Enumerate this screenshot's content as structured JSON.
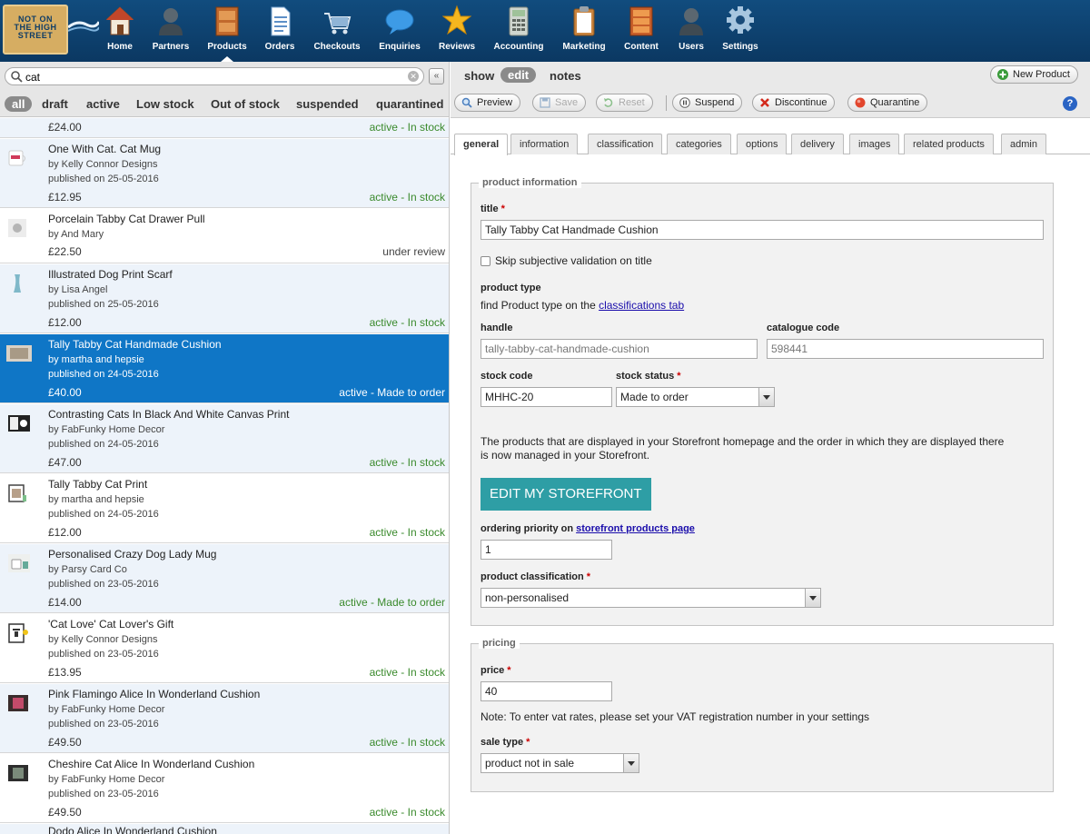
{
  "nav": {
    "logo_lines": [
      "NOT ON",
      "THE HIGH",
      "STREET"
    ],
    "items": [
      {
        "label": "Home",
        "icon": "house-icon"
      },
      {
        "label": "Partners",
        "icon": "person-icon"
      },
      {
        "label": "Products",
        "icon": "cabinet-icon",
        "active": true
      },
      {
        "label": "Orders",
        "icon": "document-icon"
      },
      {
        "label": "Checkouts",
        "icon": "cart-icon"
      },
      {
        "label": "Enquiries",
        "icon": "speech-bubble-icon"
      },
      {
        "label": "Reviews",
        "icon": "star-icon"
      },
      {
        "label": "Accounting",
        "icon": "calculator-icon"
      },
      {
        "label": "Marketing",
        "icon": "clipboard-icon"
      },
      {
        "label": "Content",
        "icon": "drawers-icon"
      },
      {
        "label": "Users",
        "icon": "users-icon"
      },
      {
        "label": "Settings",
        "icon": "gear-icon"
      }
    ]
  },
  "search": {
    "value": "cat",
    "collapse_label": "«"
  },
  "filters": [
    "all",
    "draft",
    "active",
    "Low stock",
    "Out of stock",
    "suspended",
    "quarantined"
  ],
  "products": [
    {
      "title": "",
      "by": "",
      "published": "",
      "price": "£24.00",
      "status": "active - In stock",
      "partial": true
    },
    {
      "title": "One With Cat. Cat Mug",
      "by": "by Kelly Connor Designs",
      "published": "published on 25-05-2016",
      "price": "£12.95",
      "status": "active - In stock",
      "thumb": "mug"
    },
    {
      "title": "Porcelain Tabby Cat Drawer Pull",
      "by": "by And Mary",
      "published": "",
      "price": "£22.50",
      "status": "under review",
      "thumb": "pull"
    },
    {
      "title": "Illustrated Dog Print Scarf",
      "by": "by Lisa Angel",
      "published": "published on 25-05-2016",
      "price": "£12.00",
      "status": "active - In stock",
      "thumb": "scarf"
    },
    {
      "title": "Tally Tabby Cat Handmade Cushion",
      "by": "by martha and hepsie",
      "published": "published on 24-05-2016",
      "price": "£40.00",
      "status": "active - Made to order",
      "selected": true,
      "thumb": "cushion"
    },
    {
      "title": "Contrasting Cats In Black And White Canvas Print",
      "by": "by FabFunky Home Decor",
      "published": "published on 24-05-2016",
      "price": "£47.00",
      "status": "active - In stock",
      "thumb": "canvas"
    },
    {
      "title": "Tally Tabby Cat Print",
      "by": "by martha and hepsie",
      "published": "published on 24-05-2016",
      "price": "£12.00",
      "status": "active - In stock",
      "thumb": "print"
    },
    {
      "title": "Personalised Crazy Dog Lady Mug",
      "by": "by Parsy Card Co",
      "published": "published on 23-05-2016",
      "price": "£14.00",
      "status": "active - Made to order",
      "thumb": "mug2"
    },
    {
      "title": "'Cat Love' Cat Lover's Gift",
      "by": "by Kelly Connor Designs",
      "published": "published on 23-05-2016",
      "price": "£13.95",
      "status": "active - In stock",
      "thumb": "frame"
    },
    {
      "title": "Pink Flamingo Alice In Wonderland Cushion",
      "by": "by FabFunky Home Decor",
      "published": "published on 23-05-2016",
      "price": "£49.50",
      "status": "active - In stock",
      "thumb": "cushion2"
    },
    {
      "title": "Cheshire Cat Alice In Wonderland Cushion",
      "by": "by FabFunky Home Decor",
      "published": "published on 23-05-2016",
      "price": "£49.50",
      "status": "active - In stock",
      "thumb": "cushion3"
    },
    {
      "title": "Dodo Alice In Wonderland Cushion",
      "by": "",
      "published": "",
      "price": "",
      "status": "",
      "thumb": "cushion2",
      "partial": true
    }
  ],
  "detail": {
    "views": [
      "show",
      "edit",
      "notes"
    ],
    "new_product": "New Product",
    "toolbar": {
      "preview": "Preview",
      "save": "Save",
      "reset": "Reset",
      "suspend": "Suspend",
      "discontinue": "Discontinue",
      "quarantine": "Quarantine",
      "help": "?"
    },
    "tabs": [
      "general",
      "information",
      "classification",
      "categories",
      "options",
      "delivery",
      "images",
      "related products",
      "admin"
    ],
    "product_info": {
      "legend": "product information",
      "title_label": "title",
      "title_value": "Tally Tabby Cat Handmade Cushion",
      "skip_label": "Skip subjective validation on title",
      "product_type_label": "product type",
      "product_type_text": "find Product type on the",
      "product_type_link": "classifications tab",
      "handle_label": "handle",
      "handle_value": "tally-tabby-cat-handmade-cushion",
      "catalogue_label": "catalogue code",
      "catalogue_value": "598441",
      "stock_code_label": "stock code",
      "stock_code_value": "MHHC-20",
      "stock_status_label": "stock status",
      "stock_status_value": "Made to order",
      "storefront_note_1": "The products that are displayed in your Storefront homepage and the order in which they are displayed there",
      "storefront_note_2": "is now managed in your Storefront.",
      "storefront_button": "EDIT MY STOREFRONT",
      "ordering_label": "ordering priority on",
      "ordering_link": "storefront products page",
      "ordering_value": "1",
      "classification_label": "product classification",
      "classification_value": "non-personalised"
    },
    "pricing": {
      "legend": "pricing",
      "price_label": "price",
      "price_value": "40",
      "vat_note": "Note: To enter vat rates, please set your VAT registration number in your settings",
      "sale_type_label": "sale type",
      "sale_type_value": "product not in sale"
    }
  }
}
